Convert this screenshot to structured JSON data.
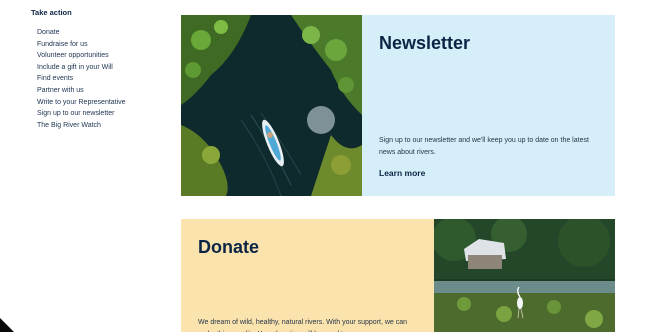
{
  "sidebar": {
    "heading": "Take action",
    "items": [
      "Donate",
      "Fundraise for us",
      "Volunteer opportunities",
      "Include a gift in your Will",
      "Find events",
      "Partner with us",
      "Write to your Representative",
      "Sign up to our newsletter",
      "The Big River Watch"
    ]
  },
  "newsletter": {
    "title": "Newsletter",
    "text": "Sign up to our newsletter and we'll keep you up to date on the latest news about rivers.",
    "link": "Learn more"
  },
  "donate": {
    "title": "Donate",
    "text": "We dream of wild, healthy, natural rivers. With your support, we can make this a reality. Your donation will be used to"
  },
  "colors": {
    "newsletter_bg": "#d6eef8",
    "donate_bg": "#fbe3ad",
    "heading": "#0b2545"
  }
}
